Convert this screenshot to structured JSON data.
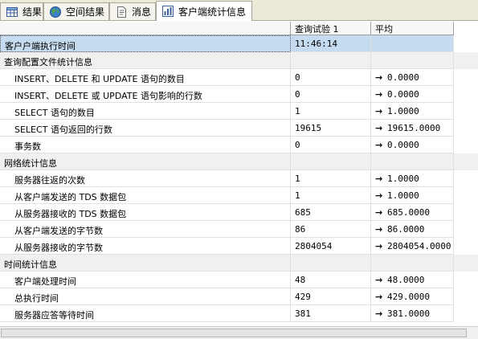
{
  "tabs": [
    {
      "label": "结果",
      "icon": "grid-icon"
    },
    {
      "label": "空间结果",
      "icon": "globe-icon"
    },
    {
      "label": "消息",
      "icon": "message-icon"
    },
    {
      "label": "客户端统计信息",
      "icon": "statistics-icon",
      "active": true
    }
  ],
  "columns": {
    "trial": "查询试验 1",
    "average": "平均"
  },
  "rows": [
    {
      "name": "客户户端执行时间",
      "value": "11:46:14",
      "average": ""
    },
    {
      "name": "查询配置文件统计信息"
    },
    {
      "name": "INSERT、DELETE 和 UPDATE 语句的数目",
      "value": "0",
      "average": "0.0000"
    },
    {
      "name": "INSERT、DELETE 或 UPDATE 语句影响的行数",
      "value": "0",
      "average": "0.0000"
    },
    {
      "name": "SELECT 语句的数目",
      "value": "1",
      "average": "1.0000"
    },
    {
      "name": "SELECT 语句返回的行数",
      "value": "19615",
      "average": "19615.0000"
    },
    {
      "name": "事务数",
      "value": "0",
      "average": "0.0000"
    },
    {
      "name": "网络统计信息"
    },
    {
      "name": "服务器往返的次数",
      "value": "1",
      "average": "1.0000"
    },
    {
      "name": "从客户端发送的 TDS 数据包",
      "value": "1",
      "average": "1.0000"
    },
    {
      "name": "从服务器接收的 TDS 数据包",
      "value": "685",
      "average": "685.0000"
    },
    {
      "name": "从客户端发送的字节数",
      "value": "86",
      "average": "86.0000"
    },
    {
      "name": "从服务器接收的字节数",
      "value": "2804054",
      "average": "2804054.0000"
    },
    {
      "name": "时间统计信息"
    },
    {
      "name": "客户端处理时间",
      "value": "48",
      "average": "48.0000"
    },
    {
      "name": "总执行时间",
      "value": "429",
      "average": "429.0000"
    },
    {
      "name": "服务器应答等待时间",
      "value": "381",
      "average": "381.0000"
    }
  ],
  "arrow": "→",
  "colors": {
    "selected_row": "#c5dbef",
    "group_row": "#f0f0f0",
    "tab_strip": "#ece9d8"
  }
}
